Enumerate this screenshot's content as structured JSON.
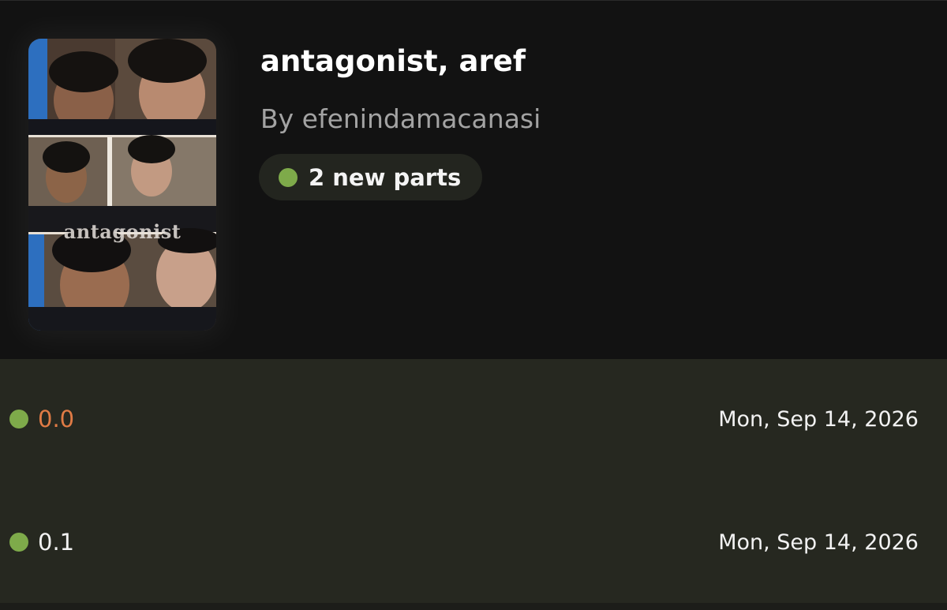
{
  "story": {
    "title": "antagonist, aref",
    "author": "By efenindamacanasi",
    "new_parts_badge": "2 new parts",
    "cover_text": "antagonist"
  },
  "parts": [
    {
      "number": "0.0",
      "date": "Mon, Sep 14, 2026",
      "is_current": true
    },
    {
      "number": "0.1",
      "date": "Mon, Sep 14, 2026",
      "is_current": false
    }
  ],
  "colors": {
    "header_bg": "#121212",
    "list_bg": "#262820",
    "new_dot": "#7eaa4a",
    "current_part": "#e07b45",
    "author_text": "#a3a3a3",
    "badge_bg": "#23251f"
  }
}
